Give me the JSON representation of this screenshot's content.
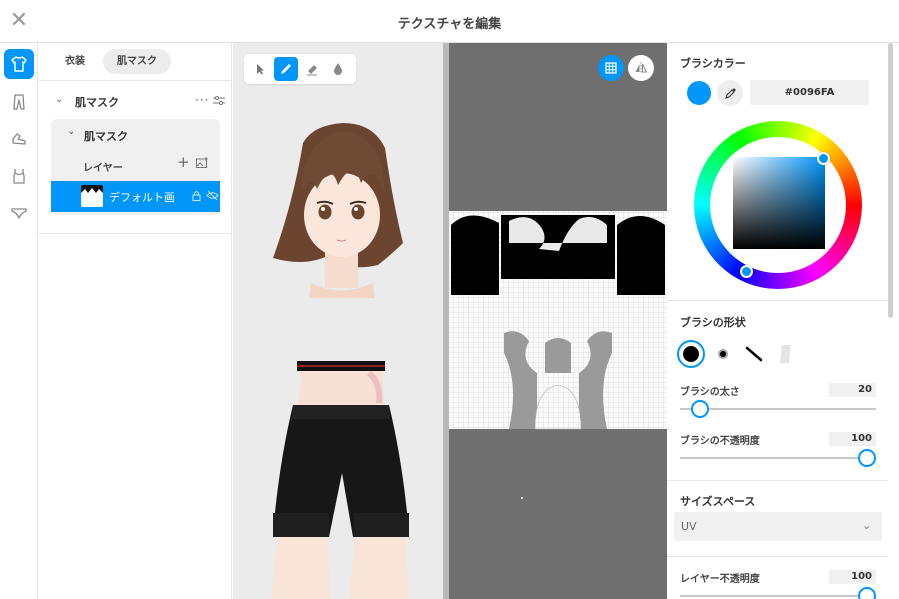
{
  "window": {
    "title": "テクスチャを編集",
    "close_glyph": "✕"
  },
  "iconbar": {
    "items": [
      {
        "icon": "shirt-icon",
        "active": true
      },
      {
        "icon": "pants-icon",
        "active": false
      },
      {
        "icon": "shoe-icon",
        "active": false
      },
      {
        "icon": "tank-top-icon",
        "active": false
      },
      {
        "icon": "underwear-icon",
        "active": false
      }
    ]
  },
  "layers_panel": {
    "tabs": [
      {
        "label": "衣装",
        "active": false
      },
      {
        "label": "肌マスク",
        "active": true
      }
    ],
    "group_label": "肌マスク",
    "subgroup_label": "肌マスク",
    "layer_header": "レイヤー",
    "plus_glyph": "+",
    "more_glyph": "···",
    "layer_row": {
      "name": "デフォルト画"
    }
  },
  "viewport": {
    "tools": [
      {
        "icon": "select-arrow-icon",
        "active": false
      },
      {
        "icon": "pen-icon",
        "active": true
      },
      {
        "icon": "eraser-icon",
        "active": false
      },
      {
        "icon": "dropper-fill-icon",
        "active": false
      }
    ]
  },
  "uv_view": {
    "buttons": [
      {
        "icon": "grid-icon",
        "active": true
      },
      {
        "icon": "mirror-icon",
        "active": false
      }
    ]
  },
  "right_panel": {
    "brush_color_title": "ブラシカラー",
    "hex_value": "#0096FA",
    "accent_color": "#0096fa",
    "brush_shape_title": "ブラシの形状",
    "brush_shapes": [
      "round-hard-icon",
      "round-soft-icon",
      "line-brush-icon",
      "texture-brush-icon"
    ],
    "brush_size_label": "ブラシの太さ",
    "brush_size_value": "20",
    "brush_opacity_label": "ブラシの不透明度",
    "brush_opacity_value": "100",
    "size_space_title": "サイズスペース",
    "size_space_value": "UV",
    "layer_opacity_label": "レイヤー不透明度",
    "layer_opacity_value": "100"
  }
}
